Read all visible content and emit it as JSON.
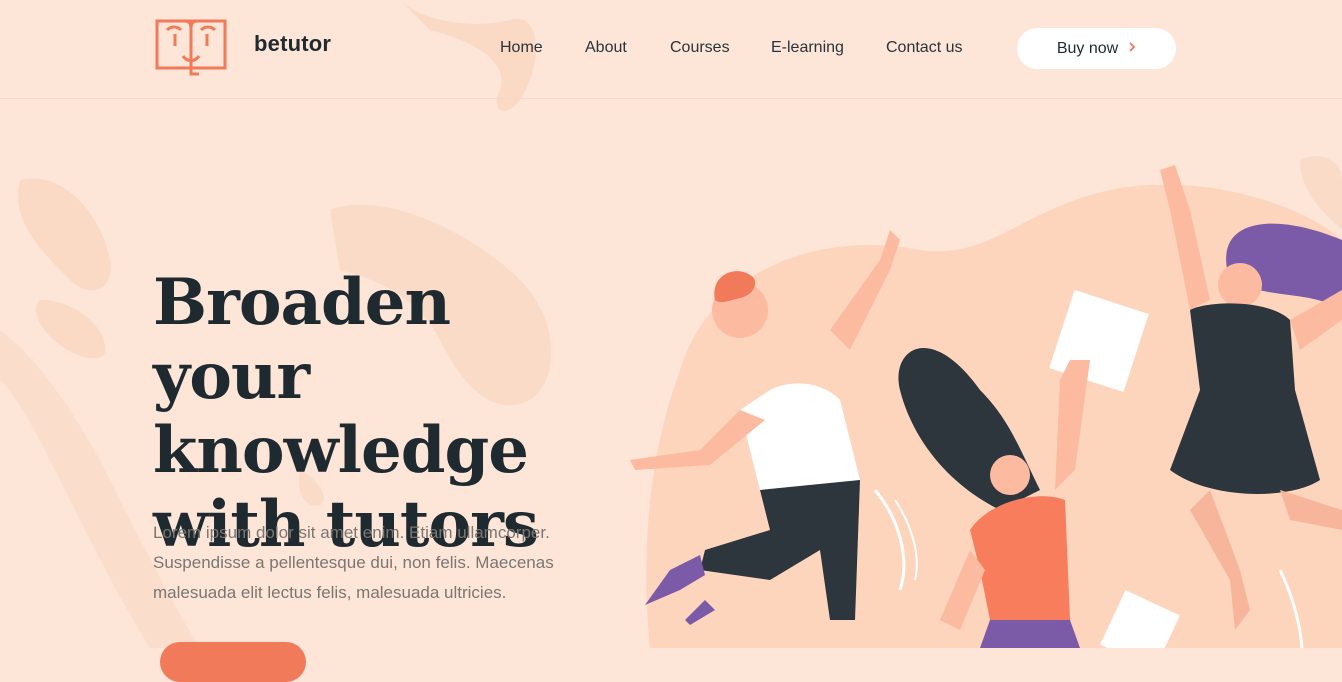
{
  "brand": {
    "name": "betutor",
    "accent_color": "#f07a5a",
    "background_color": "#fde6d8"
  },
  "nav": {
    "items": [
      {
        "label": "Home"
      },
      {
        "label": "About"
      },
      {
        "label": "Courses"
      },
      {
        "label": "E-learning"
      },
      {
        "label": "Contact us"
      }
    ],
    "buy_button": {
      "label": "Buy now",
      "icon": "chevron-right-icon"
    }
  },
  "hero": {
    "title": "Broaden your knowledge with tutors",
    "description": "Lorem ipsum dolor sit amet enim. Etiam ullamcorper. Suspendisse a pellentesque dui, non felis. Maecenas malesuada elit lectus felis, malesuada ultricies.",
    "illustration": "students-jumping-illustration"
  }
}
